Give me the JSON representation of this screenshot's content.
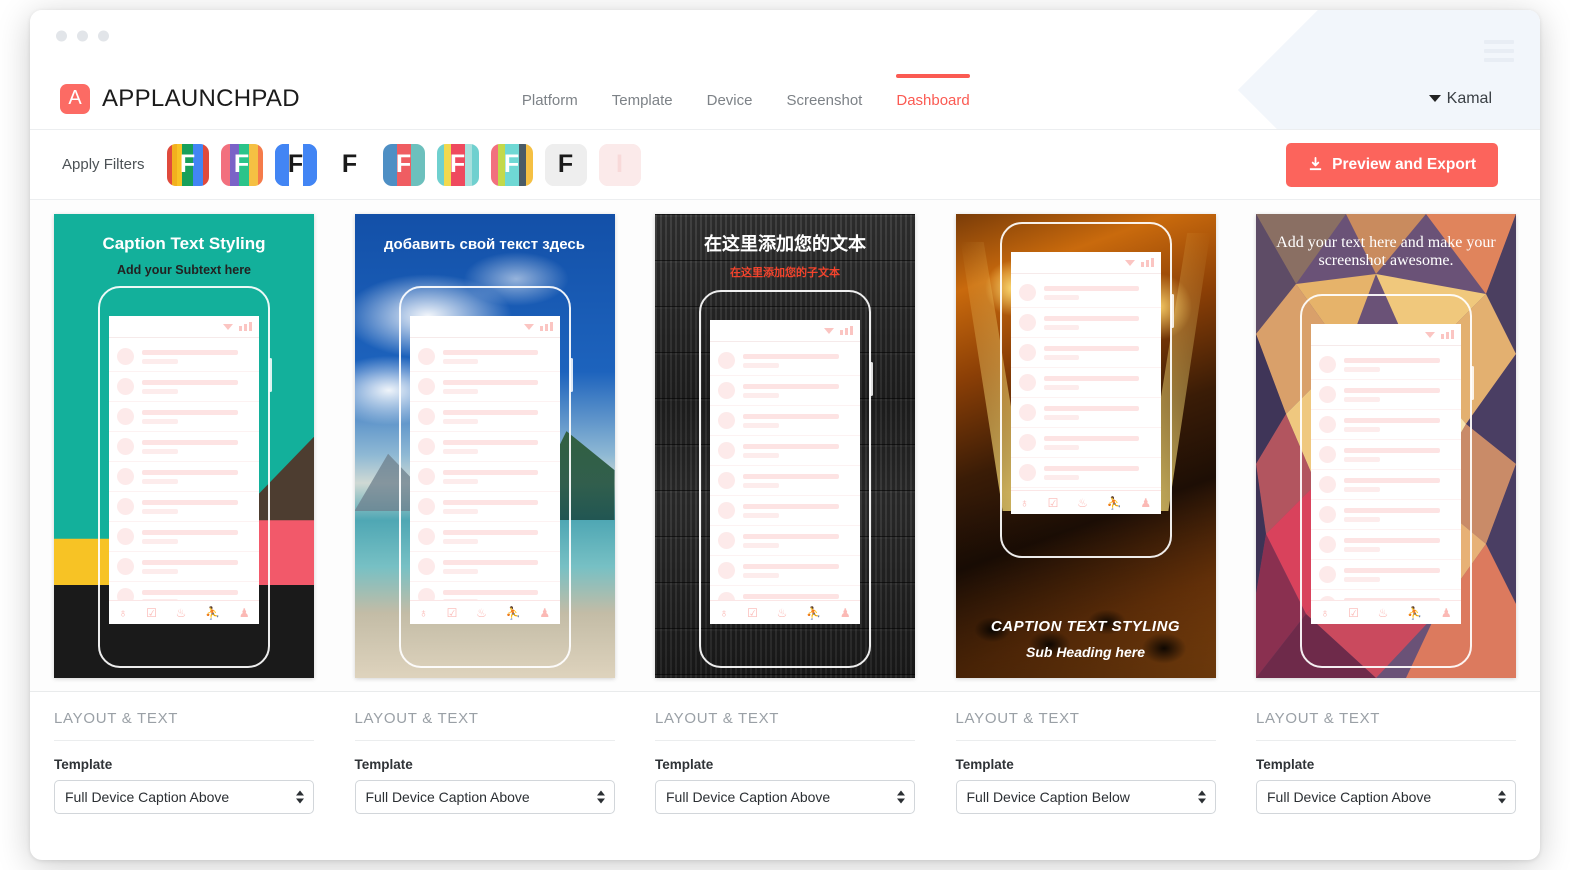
{
  "window": {
    "dot_count": 3,
    "menu_icon": "hamburger-icon"
  },
  "brand": {
    "mark_letter": "A",
    "name": "APPLAUNCHPAD",
    "mark_color": "#fc6b64"
  },
  "nav": {
    "items": [
      {
        "label": "Platform",
        "active": false
      },
      {
        "label": "Template",
        "active": false
      },
      {
        "label": "Device",
        "active": false
      },
      {
        "label": "Screenshot",
        "active": false
      },
      {
        "label": "Dashboard",
        "active": true
      }
    ],
    "active_color": "#fb5a52"
  },
  "user": {
    "name": "Kamal",
    "caret": "caret-down-icon"
  },
  "filters": {
    "label": "Apply Filters",
    "swatches": [
      {
        "name": "filter-google",
        "glyph": "F",
        "glyph_color": "#ffffff",
        "bg": "#f2f2f2",
        "stripes": [
          "#e04a3c",
          "#f2b01e",
          "#f7c325",
          "#17a05a",
          "#17a05a",
          "#4285f4",
          "#4285f4",
          "#e04a3c"
        ]
      },
      {
        "name": "filter-pastel-rainbow",
        "glyph": "F",
        "glyph_color": "#ffffff",
        "bg": "#f2f2f2",
        "stripes": [
          "#f2707e",
          "#f2707e",
          "#7a62c7",
          "#7a62c7",
          "#2bc48a",
          "#2bc48a",
          "#f5c043",
          "#f5c043",
          "#f57b4a"
        ]
      },
      {
        "name": "filter-blue",
        "glyph": "F",
        "glyph_color": "#1a1a1a",
        "bg": "#4285f4",
        "stripes": [
          "#4285f4",
          "#4285f4",
          "#ffffff",
          "#ffffff",
          "#4285f4",
          "#4285f4"
        ]
      },
      {
        "name": "filter-none",
        "glyph": "F",
        "glyph_color": "#1a1a1a",
        "bg": "#ffffff",
        "stripes": [
          "#ffffff"
        ]
      },
      {
        "name": "filter-blue-red-teal",
        "glyph": "F",
        "glyph_color": "#ffffff",
        "bg": "#f2f2f2",
        "stripes": [
          "#4e8fc4",
          "#4e8fc4",
          "#ef5d62",
          "#ef5d62",
          "#6cc0bd",
          "#6cc0bd"
        ]
      },
      {
        "name": "filter-aqua-yellow",
        "glyph": "F",
        "glyph_color": "#ffffff",
        "bg": "#f2f2f2",
        "stripes": [
          "#6fd0cf",
          "#f2d94e",
          "#ef4a5e",
          "#ef4a5e",
          "#a7e0dd",
          "#6fd0cf"
        ]
      },
      {
        "name": "filter-pink-lime",
        "glyph": "F",
        "glyph_color": "#ffffff",
        "bg": "#f2f2f2",
        "stripes": [
          "#f2707e",
          "#c3d94a",
          "#6fd8d4",
          "#6fd8d4",
          "#4a5b66",
          "#f5c043"
        ]
      },
      {
        "name": "filter-grey",
        "glyph": "F",
        "glyph_color": "#1a1a1a",
        "bg": "#eeeeee",
        "stripes": [
          "#eeeeee"
        ]
      },
      {
        "name": "filter-blush",
        "glyph": "I",
        "glyph_color": "#f8d9d9",
        "bg": "#fbeaea",
        "stripes": [
          "#fbeaea"
        ]
      }
    ]
  },
  "export_button": {
    "label": "Preview and Export",
    "icon": "download-icon",
    "color": "#fc645c"
  },
  "device_screen": {
    "row_count": 9,
    "tab_icons": [
      "globe-icon",
      "calendar-check-icon",
      "fire-icon",
      "group-icon",
      "person-icon"
    ],
    "tab_glyphs": [
      "♁",
      "☑",
      "♨",
      "⛹",
      "♟"
    ]
  },
  "cards": [
    {
      "name": "screenshot-card-1",
      "caption_position": "above",
      "title": "Caption Text Styling",
      "subtitle": "Add your Subtext here",
      "title_color": "#ffffff",
      "subtitle_color": "#222222",
      "background": "teal-geometric"
    },
    {
      "name": "screenshot-card-2",
      "caption_position": "above",
      "title": "добавить свой текст здесь",
      "subtitle": "",
      "title_color": "#ffffff",
      "subtitle_color": "#ffffff",
      "background": "beach-sky"
    },
    {
      "name": "screenshot-card-3",
      "caption_position": "above",
      "title": "在这里添加您的文本",
      "subtitle": "在这里添加您的子文本",
      "title_color": "#ffffff",
      "subtitle_color": "#f2432c",
      "background": "dark-wood"
    },
    {
      "name": "screenshot-card-4",
      "caption_position": "below",
      "title": "CAPTION TEXT STYLING",
      "subtitle": "Sub Heading here",
      "title_color": "#ffffff",
      "subtitle_color": "#ffffff",
      "background": "concert-fire"
    },
    {
      "name": "screenshot-card-5",
      "caption_position": "above",
      "title": "Add your text here and make your screenshot awesome.",
      "subtitle": "",
      "title_color": "#ffffff",
      "subtitle_color": "#ffffff",
      "background": "low-poly"
    }
  ],
  "controls": [
    {
      "section": "LAYOUT & TEXT",
      "field_label": "Template",
      "value": "Full Device Caption Above"
    },
    {
      "section": "LAYOUT & TEXT",
      "field_label": "Template",
      "value": "Full Device Caption Above"
    },
    {
      "section": "LAYOUT & TEXT",
      "field_label": "Template",
      "value": "Full Device Caption Above"
    },
    {
      "section": "LAYOUT & TEXT",
      "field_label": "Template",
      "value": "Full Device Caption Below"
    },
    {
      "section": "LAYOUT & TEXT",
      "field_label": "Template",
      "value": "Full Device Caption Above"
    }
  ]
}
